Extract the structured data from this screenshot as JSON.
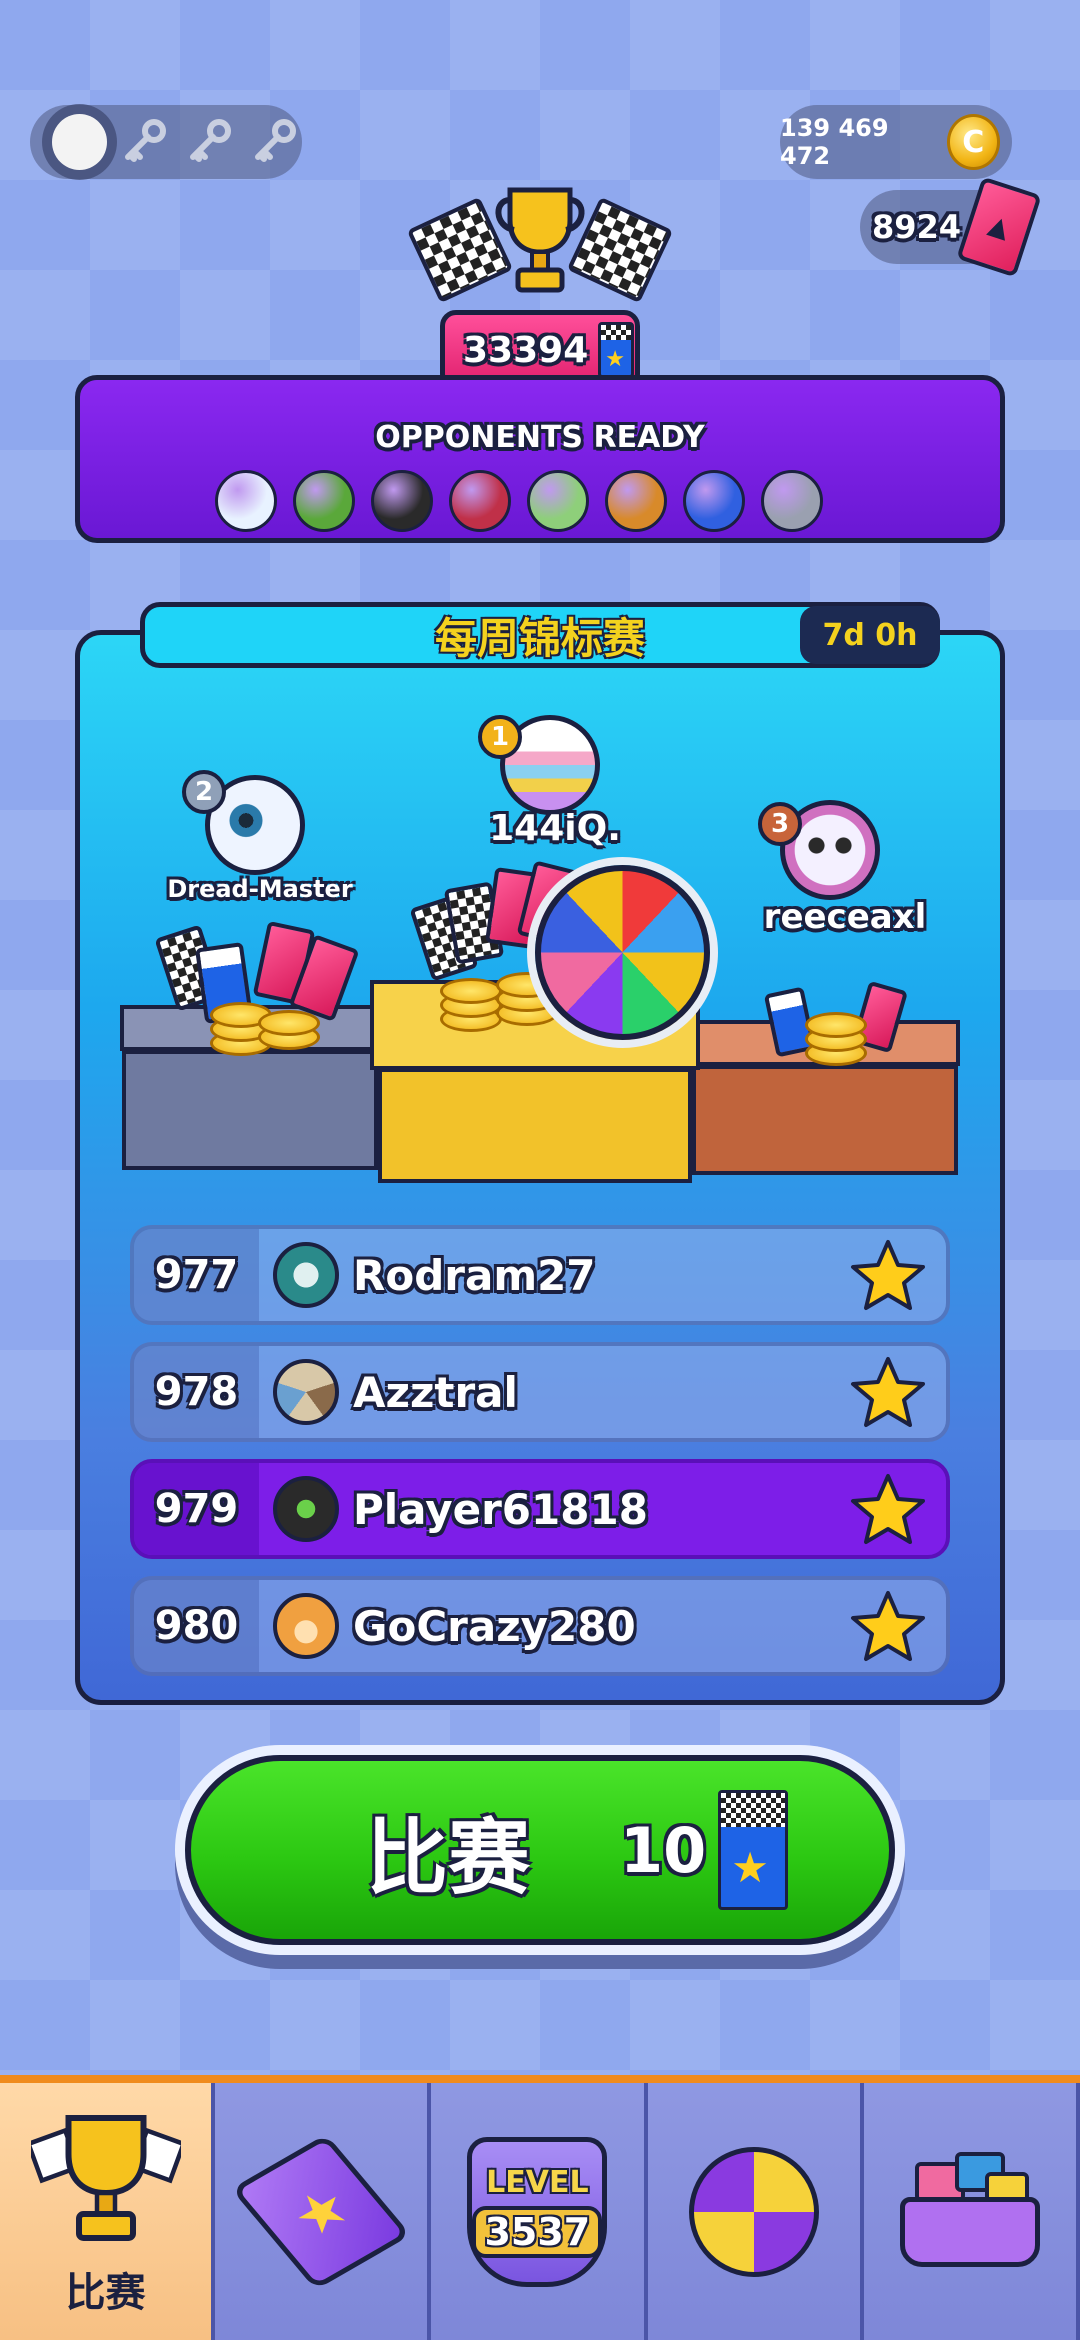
{
  "header": {
    "coins": "139 469 472",
    "tickets": "8924",
    "trophy_score": "33394"
  },
  "opponents": {
    "title": "OPPONENTS READY",
    "balls": [
      {
        "name": "eyeball",
        "color": "#e8f2ff"
      },
      {
        "name": "grass-block",
        "color": "#5aa83a"
      },
      {
        "name": "bomb",
        "color": "#2a2a2a"
      },
      {
        "name": "helmet",
        "color": "#c03048"
      },
      {
        "name": "green-ball",
        "color": "#8ecf7a"
      },
      {
        "name": "burger",
        "color": "#d88a2a"
      },
      {
        "name": "knot",
        "color": "#3060e0"
      },
      {
        "name": "can",
        "color": "#9aa0b0"
      }
    ]
  },
  "tournament": {
    "title": "每周锦标赛",
    "timer": "7d 0h",
    "podium": [
      {
        "rank": "1",
        "name": "144iQ.",
        "rank_color": "#f2b21a"
      },
      {
        "rank": "2",
        "name": "Dread-Master",
        "rank_color": "#8fa0b8"
      },
      {
        "rank": "3",
        "name": "reeceaxl",
        "rank_color": "#c8643a"
      }
    ],
    "rows": [
      {
        "rank": "977",
        "name": "Rodram27",
        "avatar_color": "#3a9a9a",
        "highlight": false
      },
      {
        "rank": "978",
        "name": "Azztral",
        "avatar_color": "#c09a6a",
        "highlight": false
      },
      {
        "rank": "979",
        "name": "Player61818",
        "avatar_color": "#3a3a3a",
        "highlight": true
      },
      {
        "rank": "980",
        "name": "GoCrazy280",
        "avatar_color": "#f0a040",
        "highlight": false
      }
    ]
  },
  "play_button": {
    "label": "比赛",
    "cost": "10"
  },
  "bottom_nav": {
    "tabs": [
      {
        "id": "race",
        "label": "比赛",
        "active": true
      },
      {
        "id": "cards",
        "label": "",
        "active": false
      },
      {
        "id": "level",
        "label": "",
        "active": false
      },
      {
        "id": "balls",
        "label": "",
        "active": false
      },
      {
        "id": "shop",
        "label": "",
        "active": false
      }
    ],
    "level_label": "LEVEL",
    "level_value": "3537"
  }
}
